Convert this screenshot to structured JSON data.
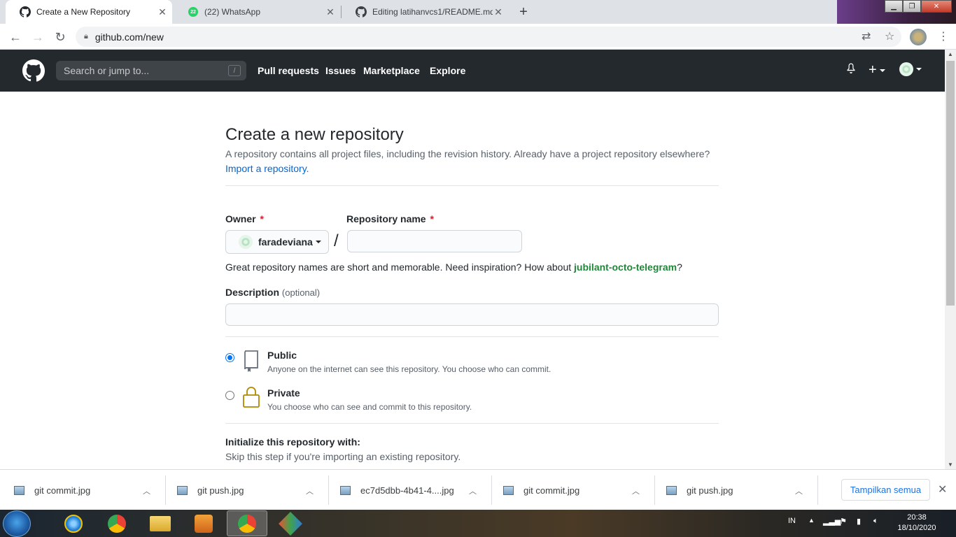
{
  "browser": {
    "tabs": [
      {
        "title": "Create a New Repository",
        "icon": "github-icon",
        "active": true
      },
      {
        "title": "(22) WhatsApp",
        "icon": "whatsapp-icon",
        "badge": "22",
        "active": false
      },
      {
        "title": "Editing latihanvcs1/README.md",
        "icon": "github-icon",
        "active": false
      }
    ],
    "url": "github.com/new"
  },
  "github": {
    "search_placeholder": "Search or jump to...",
    "search_shortcut": "/",
    "nav": [
      "Pull requests",
      "Issues",
      "Marketplace",
      "Explore"
    ]
  },
  "page": {
    "title": "Create a new repository",
    "description": "A repository contains all project files, including the revision history. Already have a project repository elsewhere?",
    "import_link": "Import a repository.",
    "owner_label": "Owner",
    "owner_value": "faradeviana",
    "repo_name_label": "Repository name",
    "required_mark": "*",
    "separator": "/",
    "hint_prefix": "Great repository names are short and memorable. Need inspiration? How about",
    "hint_suggestion": "jubilant-octo-telegram",
    "hint_suffix": "?",
    "description_label": "Description",
    "description_optional": "(optional)",
    "visibility": [
      {
        "title": "Public",
        "note": "Anyone on the internet can see this repository. You choose who can commit.",
        "checked": true,
        "icon": "repo-icon"
      },
      {
        "title": "Private",
        "note": "You choose who can see and commit to this repository.",
        "checked": false,
        "icon": "lock-icon"
      }
    ],
    "init_title": "Initialize this repository with:",
    "init_note": "Skip this step if you're importing an existing repository."
  },
  "downloads": {
    "items": [
      "git commit.jpg",
      "git push.jpg",
      "ec7d5dbb-4b41-4....jpg",
      "git commit.jpg",
      "git push.jpg"
    ],
    "show_all": "Tampilkan semua"
  },
  "taskbar": {
    "lang": "IN",
    "time": "20:38",
    "date": "18/10/2020"
  }
}
